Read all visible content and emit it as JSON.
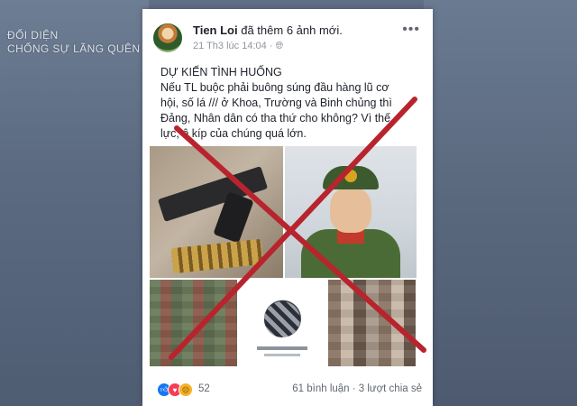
{
  "watermark": {
    "line1": "ĐỐI DIỆN",
    "line2": "CHỐNG SỰ LÃNG QUÊN"
  },
  "post": {
    "author": "Tien Loi",
    "action": "đã thêm 6 ảnh mới.",
    "date": "21 Th3 lúc 14:04",
    "privacy_icon": "globe-icon",
    "more_icon": "•••",
    "text_lines": [
      "DỰ KIẾN TÌNH HUỐNG",
      "Nếu TL buộc phải buông súng đầu hàng lũ cơ",
      "hội, số lá /// ở Khoa, Trường và Binh chủng thì",
      "Đảng, Nhân dân có tha thứ cho không? Vì thế",
      "lực, ê kíp của chúng quá lớn."
    ]
  },
  "footer": {
    "reaction_count": "52",
    "comments_shares": "61 bình luận · 3 lượt chia sẻ"
  },
  "colors": {
    "cross": "#b8242d",
    "link_blue": "#1877f2"
  }
}
